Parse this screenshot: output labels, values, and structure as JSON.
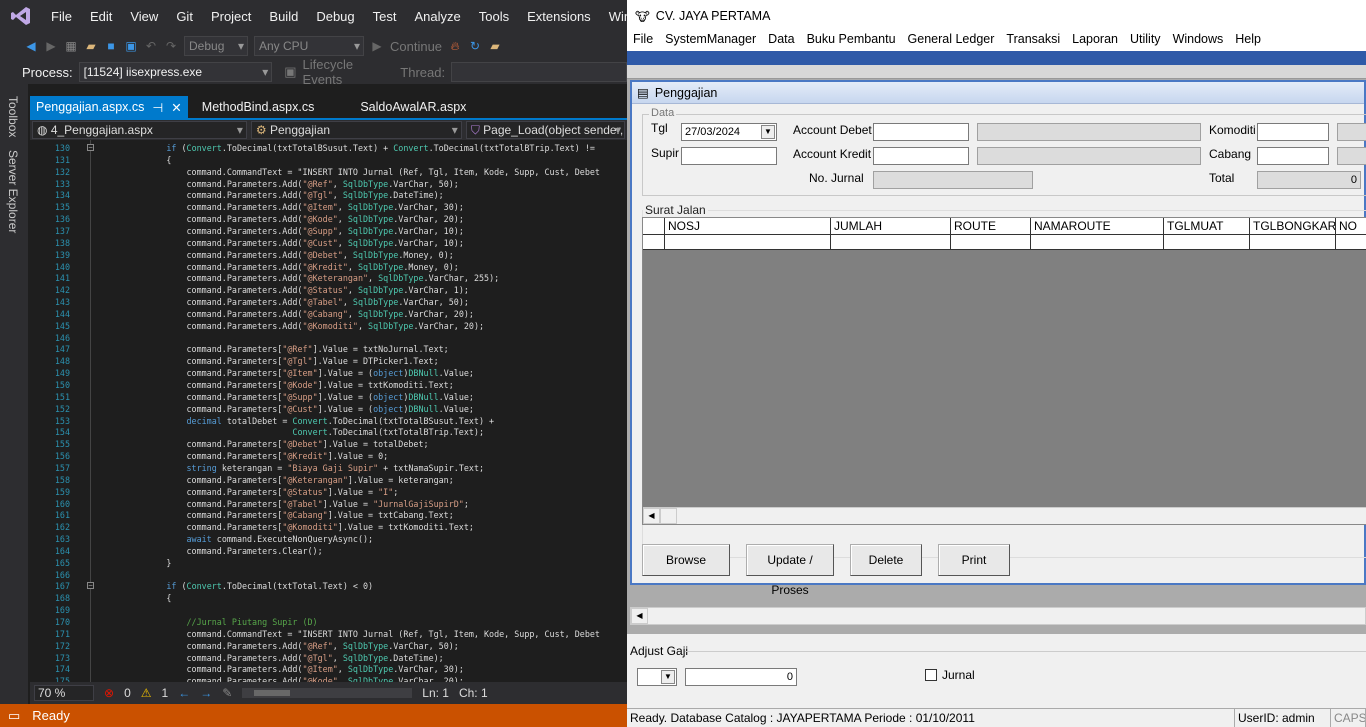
{
  "vs": {
    "menu": [
      "File",
      "Edit",
      "View",
      "Git",
      "Project",
      "Build",
      "Debug",
      "Test",
      "Analyze",
      "Tools",
      "Extensions",
      "Windo"
    ],
    "toolbar": {
      "config": "Debug",
      "platform": "Any CPU",
      "continue": "Continue"
    },
    "process": {
      "label": "Process:",
      "value": "[11524] iisexpress.exe",
      "lifecycle": "Lifecycle Events",
      "thread": "Thread:"
    },
    "side": {
      "toolbox": "Toolbox",
      "server_explorer": "Server Explorer"
    },
    "tabs": [
      {
        "label": "Penggajian.aspx.cs",
        "pin": "⊣",
        "close": "✕"
      },
      {
        "label": "MethodBind.aspx.cs"
      },
      {
        "label": "SaldoAwalAR.aspx"
      }
    ],
    "nav": {
      "project": "4_Penggajian.aspx",
      "class": "Penggajian",
      "member": "Page_Load(object sender,"
    },
    "code": [
      {
        "n": "130",
        "t": "        if (Convert.ToDecimal(txtTotalBSusut.Text) + Convert.ToDecimal(txtTotalBTrip.Text) !="
      },
      {
        "n": "131",
        "t": "        {"
      },
      {
        "n": "132",
        "t": "            command.CommandText = \"INSERT INTO Jurnal (Ref, Tgl, Item, Kode, Supp, Cust, Debet"
      },
      {
        "n": "133",
        "t": "            command.Parameters.Add(\"@Ref\", SqlDbType.VarChar, 50);"
      },
      {
        "n": "134",
        "t": "            command.Parameters.Add(\"@Tgl\", SqlDbType.DateTime);"
      },
      {
        "n": "135",
        "t": "            command.Parameters.Add(\"@Item\", SqlDbType.VarChar, 30);"
      },
      {
        "n": "136",
        "t": "            command.Parameters.Add(\"@Kode\", SqlDbType.VarChar, 20);"
      },
      {
        "n": "137",
        "t": "            command.Parameters.Add(\"@Supp\", SqlDbType.VarChar, 10);"
      },
      {
        "n": "138",
        "t": "            command.Parameters.Add(\"@Cust\", SqlDbType.VarChar, 10);"
      },
      {
        "n": "139",
        "t": "            command.Parameters.Add(\"@Debet\", SqlDbType.Money, 0);"
      },
      {
        "n": "140",
        "t": "            command.Parameters.Add(\"@Kredit\", SqlDbType.Money, 0);"
      },
      {
        "n": "141",
        "t": "            command.Parameters.Add(\"@Keterangan\", SqlDbType.VarChar, 255);"
      },
      {
        "n": "142",
        "t": "            command.Parameters.Add(\"@Status\", SqlDbType.VarChar, 1);"
      },
      {
        "n": "143",
        "t": "            command.Parameters.Add(\"@Tabel\", SqlDbType.VarChar, 50);"
      },
      {
        "n": "144",
        "t": "            command.Parameters.Add(\"@Cabang\", SqlDbType.VarChar, 20);"
      },
      {
        "n": "145",
        "t": "            command.Parameters.Add(\"@Komoditi\", SqlDbType.VarChar, 20);"
      },
      {
        "n": "146",
        "t": ""
      },
      {
        "n": "147",
        "t": "            command.Parameters[\"@Ref\"].Value = txtNoJurnal.Text;"
      },
      {
        "n": "148",
        "t": "            command.Parameters[\"@Tgl\"].Value = DTPicker1.Text;"
      },
      {
        "n": "149",
        "t": "            command.Parameters[\"@Item\"].Value = (object)DBNull.Value;"
      },
      {
        "n": "150",
        "t": "            command.Parameters[\"@Kode\"].Value = txtKomoditi.Text;"
      },
      {
        "n": "151",
        "t": "            command.Parameters[\"@Supp\"].Value = (object)DBNull.Value;"
      },
      {
        "n": "152",
        "t": "            command.Parameters[\"@Cust\"].Value = (object)DBNull.Value;"
      },
      {
        "n": "153",
        "t": "            decimal totalDebet = Convert.ToDecimal(txtTotalBSusut.Text) +"
      },
      {
        "n": "154",
        "t": "                                 Convert.ToDecimal(txtTotalBTrip.Text);"
      },
      {
        "n": "155",
        "t": "            command.Parameters[\"@Debet\"].Value = totalDebet;"
      },
      {
        "n": "156",
        "t": "            command.Parameters[\"@Kredit\"].Value = 0;"
      },
      {
        "n": "157",
        "t": "            string keterangan = \"Biaya Gaji Supir\" + txtNamaSupir.Text;"
      },
      {
        "n": "158",
        "t": "            command.Parameters[\"@Keterangan\"].Value = keterangan;"
      },
      {
        "n": "159",
        "t": "            command.Parameters[\"@Status\"].Value = \"I\";"
      },
      {
        "n": "160",
        "t": "            command.Parameters[\"@Tabel\"].Value = \"JurnalGajiSupirD\";"
      },
      {
        "n": "161",
        "t": "            command.Parameters[\"@Cabang\"].Value = txtCabang.Text;"
      },
      {
        "n": "162",
        "t": "            command.Parameters[\"@Komoditi\"].Value = txtKomoditi.Text;"
      },
      {
        "n": "163",
        "t": "            await command.ExecuteNonQueryAsync();"
      },
      {
        "n": "164",
        "t": "            command.Parameters.Clear();"
      },
      {
        "n": "165",
        "t": "        }"
      },
      {
        "n": "166",
        "t": ""
      },
      {
        "n": "167",
        "t": "        if (Convert.ToDecimal(txtTotal.Text) < 0)"
      },
      {
        "n": "168",
        "t": "        {"
      },
      {
        "n": "169",
        "t": ""
      },
      {
        "n": "170",
        "t": "            //Jurnal Piutang Supir (D)"
      },
      {
        "n": "171",
        "t": "            command.CommandText = \"INSERT INTO Jurnal (Ref, Tgl, Item, Kode, Supp, Cust, Debet"
      },
      {
        "n": "172",
        "t": "            command.Parameters.Add(\"@Ref\", SqlDbType.VarChar, 50);"
      },
      {
        "n": "173",
        "t": "            command.Parameters.Add(\"@Tgl\", SqlDbType.DateTime);"
      },
      {
        "n": "174",
        "t": "            command.Parameters.Add(\"@Item\", SqlDbType.VarChar, 30);"
      },
      {
        "n": "175",
        "t": "            command.Parameters.Add(\"@Kode\", SqlDbType.VarChar, 20);"
      }
    ],
    "status2": {
      "zoom": "70 %",
      "errors": "0",
      "warnings": "1",
      "ln": "Ln: 1",
      "ch": "Ch: 1"
    },
    "status": "Ready",
    "colors": {
      "accent": "#007acc",
      "status_bar": "#ca5100"
    }
  },
  "app": {
    "title": "CV. JAYA PERTAMA",
    "menu": [
      "File",
      "SystemManager",
      "Data",
      "Buku Pembantu",
      "General Ledger",
      "Transaksi",
      "Laporan",
      "Utility",
      "Windows",
      "Help"
    ],
    "child_title": "Penggajian",
    "data_group": "Data",
    "fields": {
      "tgl_label": "Tgl",
      "tgl_value": "27/03/2024",
      "supir_label": "Supir",
      "supir_value": "",
      "account_debet_label": "Account Debet",
      "account_debet_value": "",
      "account_kredit_label": "Account Kredit",
      "account_kredit_value": "",
      "no_jurnal_label": "No. Jurnal",
      "no_jurnal_value": "",
      "komoditi_label": "Komoditi",
      "komoditi_value": "",
      "cabang_label": "Cabang",
      "cabang_value": "",
      "total_label": "Total",
      "total_value": "0"
    },
    "surat_jalan": "Surat Jalan",
    "grid_columns": [
      "NOSJ",
      "JUMLAH",
      "ROUTE",
      "NAMAROUTE",
      "TGLMUAT",
      "TGLBONGKAR",
      "NO"
    ],
    "buttons": {
      "browse": "Browse",
      "update": "Update / Proses",
      "delete": "Delete",
      "print": "Print"
    },
    "adjust": {
      "label": "Adjust Gaji",
      "value": "0",
      "jurnal": "Jurnal"
    },
    "status": {
      "main": "Ready. Database Catalog : JAYAPERTAMA Periode : 01/10/2011",
      "user": "UserID: admin",
      "caps": "CAPS"
    }
  }
}
